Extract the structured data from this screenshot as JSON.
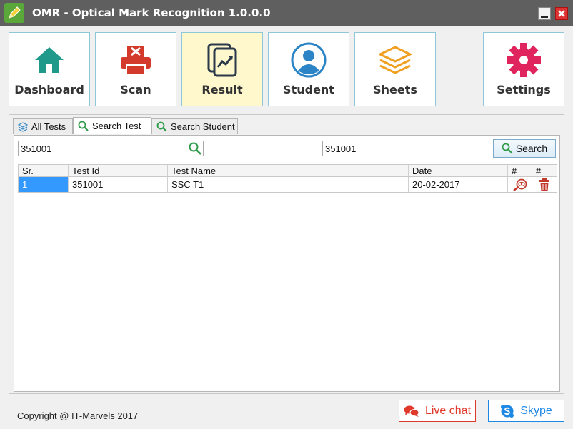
{
  "window": {
    "title": "OMR - Optical Mark Recognition 1.0.0.0"
  },
  "toolbar": {
    "items": [
      {
        "label": "Dashboard",
        "icon": "home-icon",
        "color": "#1f9a8a"
      },
      {
        "label": "Scan",
        "icon": "printer-icon",
        "color": "#d33a2c"
      },
      {
        "label": "Result",
        "icon": "chart-document-icon",
        "color": "#2a3a4a",
        "active": true
      },
      {
        "label": "Student",
        "icon": "user-icon",
        "color": "#2b84c6"
      },
      {
        "label": "Sheets",
        "icon": "layers-icon",
        "color": "#f0a020"
      },
      {
        "label": "Settings",
        "icon": "gear-icon",
        "color": "#e0245e"
      }
    ]
  },
  "tabs": [
    {
      "label": "All Tests",
      "icon": "stack-icon"
    },
    {
      "label": "Search Test",
      "icon": "search-icon",
      "active": true
    },
    {
      "label": "Search Student",
      "icon": "search-icon"
    }
  ],
  "search": {
    "test_input_value": "351001",
    "second_input_value": "351001",
    "button_label": "Search"
  },
  "grid": {
    "headers": [
      "Sr.",
      "Test Id",
      "Test Name",
      "Date",
      "#",
      "#"
    ],
    "rows": [
      {
        "sr": "1",
        "test_id": "351001",
        "test_name": "SSC T1",
        "date": "20-02-2017",
        "view_icon": "view-icon",
        "delete_icon": "trash-icon"
      }
    ]
  },
  "footer": {
    "copyright": "Copyright @ IT-Marvels 2017",
    "live_chat_label": "Live chat",
    "skype_label": "Skype",
    "live_chat_color": "#e0392b",
    "skype_color": "#1e88e5"
  }
}
